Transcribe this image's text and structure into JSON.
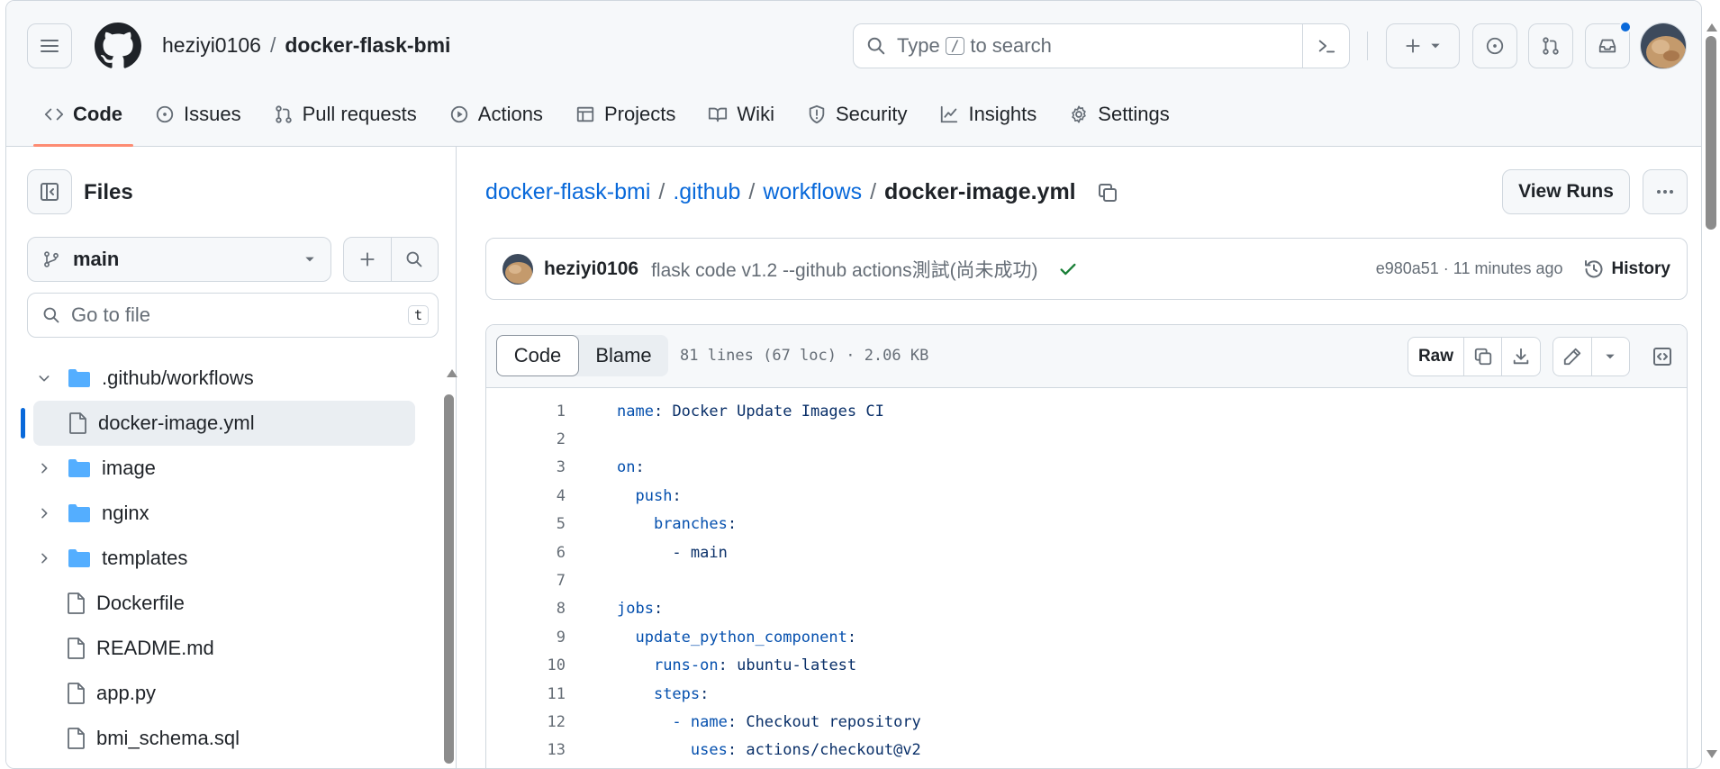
{
  "repo": {
    "owner": "heziyi0106",
    "separator": "/",
    "name": "docker-flask-bmi"
  },
  "search": {
    "prefix": "Type",
    "key": "/",
    "suffix": "to search"
  },
  "tabs": [
    {
      "label": "Code",
      "icon": "code-icon"
    },
    {
      "label": "Issues",
      "icon": "issue-icon"
    },
    {
      "label": "Pull requests",
      "icon": "pull-request-icon"
    },
    {
      "label": "Actions",
      "icon": "play-icon"
    },
    {
      "label": "Projects",
      "icon": "table-icon"
    },
    {
      "label": "Wiki",
      "icon": "book-icon"
    },
    {
      "label": "Security",
      "icon": "shield-icon"
    },
    {
      "label": "Insights",
      "icon": "graph-icon"
    },
    {
      "label": "Settings",
      "icon": "gear-icon"
    }
  ],
  "sidebar": {
    "title": "Files",
    "branch": "main",
    "goto_placeholder": "Go to file",
    "goto_shortcut": "t",
    "tree": [
      {
        "name": ".github/workflows",
        "type": "folder",
        "expanded": true
      },
      {
        "name": "docker-image.yml",
        "type": "file",
        "selected": true
      },
      {
        "name": "image",
        "type": "folder"
      },
      {
        "name": "nginx",
        "type": "folder"
      },
      {
        "name": "templates",
        "type": "folder"
      },
      {
        "name": "Dockerfile",
        "type": "file"
      },
      {
        "name": "README.md",
        "type": "file"
      },
      {
        "name": "app.py",
        "type": "file"
      },
      {
        "name": "bmi_schema.sql",
        "type": "file"
      }
    ]
  },
  "breadcrumb": {
    "parts": [
      "docker-flask-bmi",
      ".github",
      "workflows"
    ],
    "separator": "/",
    "current": "docker-image.yml"
  },
  "actions": {
    "view_runs": "View Runs"
  },
  "commit": {
    "author": "heziyi0106",
    "message": "flask code v1.2 --github actions測試(尚未成功)",
    "meta": "e980a51 · 11 minutes ago",
    "history_label": "History"
  },
  "file_view": {
    "tab_code": "Code",
    "tab_blame": "Blame",
    "info": "81 lines (67 loc) · 2.06 KB",
    "raw_label": "Raw"
  },
  "code_lines": [
    {
      "num": "1",
      "key": "name",
      "val": "Docker Update Images CI",
      "indent": ""
    },
    {
      "num": "2",
      "key": "",
      "val": "",
      "indent": ""
    },
    {
      "num": "3",
      "key": "on",
      "val": "",
      "indent": ""
    },
    {
      "num": "4",
      "key": "push",
      "val": "",
      "indent": "  "
    },
    {
      "num": "5",
      "key": "branches",
      "val": "",
      "indent": "    "
    },
    {
      "num": "6",
      "key": "",
      "val": "- main",
      "indent": "      "
    },
    {
      "num": "7",
      "key": "",
      "val": "",
      "indent": ""
    },
    {
      "num": "8",
      "key": "jobs",
      "val": "",
      "indent": ""
    },
    {
      "num": "9",
      "key": "update_python_component",
      "val": "",
      "indent": "  "
    },
    {
      "num": "10",
      "key": "runs-on",
      "val": "ubuntu-latest",
      "indent": "    "
    },
    {
      "num": "11",
      "key": "steps",
      "val": "",
      "indent": "    "
    },
    {
      "num": "12",
      "key": "- name",
      "val": "Checkout repository",
      "indent": "      "
    },
    {
      "num": "13",
      "key": "uses",
      "val": "actions/checkout@v2",
      "indent": "        "
    }
  ],
  "colors": {
    "link": "#0969da",
    "success": "#1a7f37",
    "tab_underline": "#fd8c73",
    "notification": "#0969da"
  }
}
